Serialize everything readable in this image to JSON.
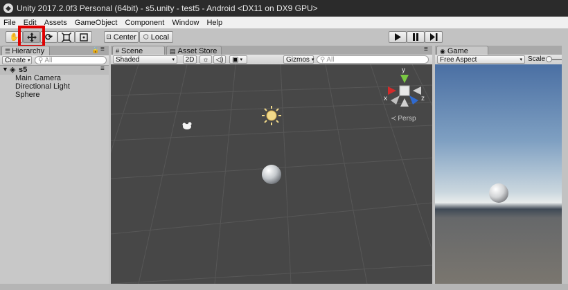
{
  "window": {
    "title": "Unity 2017.2.0f3 Personal (64bit) - s5.unity - test5 - Android <DX11 on DX9 GPU>"
  },
  "menu": [
    "File",
    "Edit",
    "Assets",
    "GameObject",
    "Component",
    "Window",
    "Help"
  ],
  "toolbar": {
    "tools": [
      "hand-tool",
      "move-tool",
      "rotate-tool",
      "scale-tool",
      "rect-tool"
    ],
    "selected_tool": "move-tool",
    "pivot_label": "Center",
    "space_label": "Local",
    "highlight_color": "#e00000"
  },
  "hierarchy": {
    "tab_label": "Hierarchy",
    "create_label": "Create",
    "search_placeholder": "All",
    "scene_name": "s5",
    "items": [
      "Main Camera",
      "Directional Light",
      "Sphere"
    ]
  },
  "scene": {
    "tabs": [
      "Scene",
      "Asset Store"
    ],
    "shading_mode": "Shaded",
    "mode_2d_label": "2D",
    "gizmos_label": "Gizmos",
    "search_placeholder": "All",
    "axes": {
      "y": "y",
      "x": "x",
      "z": "z"
    },
    "projection_label": "Persp",
    "background_color": "#474747"
  },
  "game": {
    "tab_label": "Game",
    "aspect_label": "Free Aspect",
    "scale_label": "Scale"
  }
}
